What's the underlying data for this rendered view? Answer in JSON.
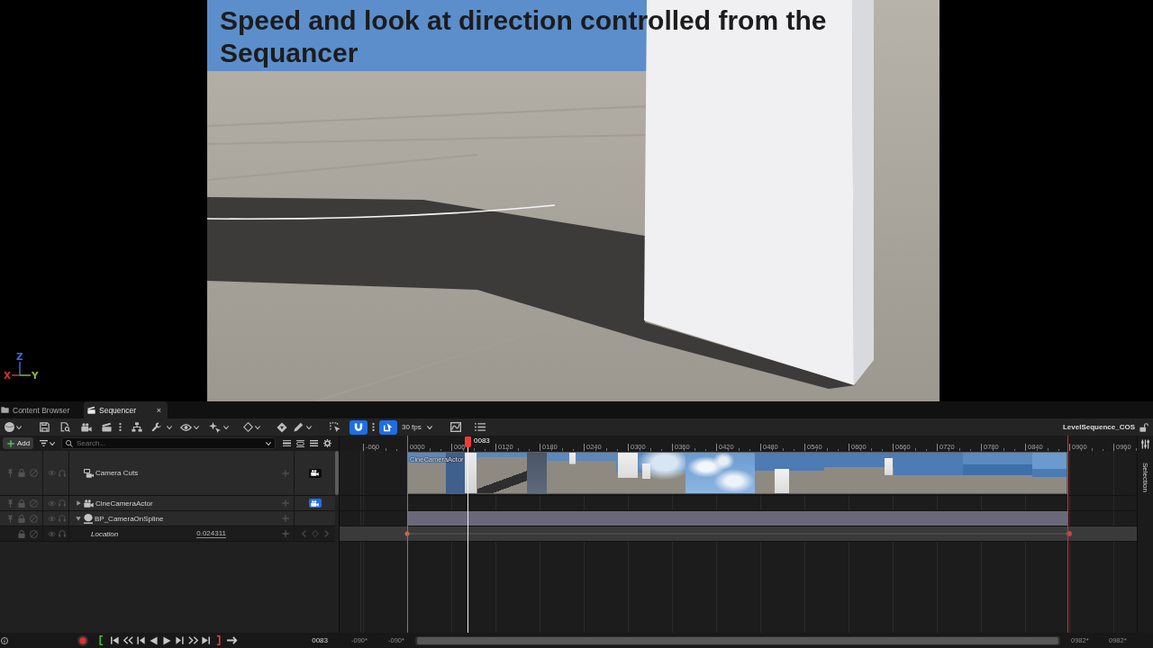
{
  "viewport": {
    "caption": "Speed and look at direction controlled from the Sequancer",
    "axes": [
      {
        "label": "Z",
        "color": "#2f6fe0"
      },
      {
        "label": "X",
        "color": "#d2342a"
      },
      {
        "label": "Y",
        "color": "#8db33a"
      }
    ]
  },
  "tabs": [
    {
      "label": "Content Browser",
      "selected": false
    },
    {
      "label": "Sequencer",
      "selected": true,
      "close": "×"
    }
  ],
  "toolbar": {
    "toggles": [
      {
        "on": true
      },
      {
        "on": true
      }
    ],
    "frame_rate": "30 fps",
    "sequence_name": "LevelSequence_COS"
  },
  "outliner": {
    "add_button": "Add",
    "search": {
      "placeholder": "Search..."
    },
    "tracks": [
      {
        "kind": "camera-cuts",
        "label": "Camera Cuts",
        "section": "CineCameraActor",
        "camera_lock": {
          "on": false
        }
      },
      {
        "kind": "camera",
        "label": "CineCameraActor",
        "expanded": false,
        "camera_lock": {
          "on": true
        }
      },
      {
        "kind": "actor",
        "label": "BP_CameraOnSpline",
        "expanded": true,
        "children": [
          {
            "kind": "property",
            "label": "Location",
            "value": "0.024311"
          }
        ]
      }
    ]
  },
  "timeline": {
    "ruler": [
      "-060",
      "0000",
      "006",
      "0120",
      "0180",
      "0240",
      "0300",
      "0360",
      "0420",
      "0480",
      "0540",
      "0600",
      "0660",
      "0720",
      "0780",
      "0840",
      "0900",
      "0960"
    ],
    "playhead": "0083"
  },
  "side_panel": {
    "tab": "Selection"
  },
  "bottom_bar": {
    "current_frame": "0083",
    "range_fields": [
      "-090*",
      "-090*",
      "0982*",
      "0982*"
    ]
  }
}
